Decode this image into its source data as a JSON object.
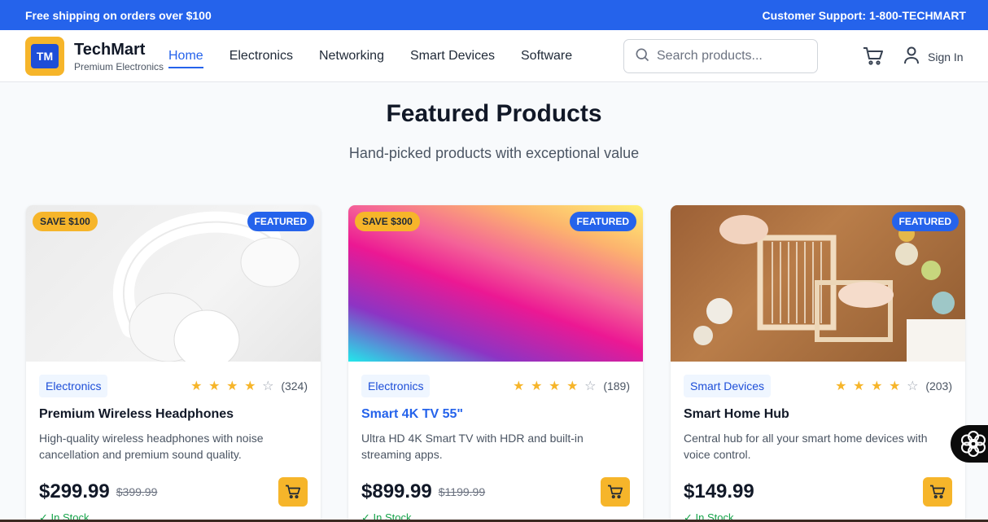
{
  "topbar": {
    "shipping": "Free shipping on orders over $100",
    "support": "Customer Support: 1-800-TECHMART"
  },
  "header": {
    "logo_initials": "TM",
    "brand_name": "TechMart",
    "brand_tagline": "Premium Electronics",
    "nav": [
      "Home",
      "Electronics",
      "Networking",
      "Smart Devices",
      "Software"
    ],
    "active_nav": "Home",
    "search_placeholder": "Search products...",
    "sign_in": "Sign In",
    "cart_icon": "cart-icon",
    "user_icon": "user-icon",
    "search_icon": "search-icon"
  },
  "section": {
    "title": "Featured Products",
    "subtitle": "Hand-picked products with exceptional value"
  },
  "products": [
    {
      "save_badge": "SAVE $100",
      "featured_badge": "FEATURED",
      "category": "Electronics",
      "stars": 4,
      "reviews": "(324)",
      "name": "Premium Wireless Headphones",
      "description": "High-quality wireless headphones with noise cancellation and premium sound quality.",
      "price": "$299.99",
      "old_price": "$399.99",
      "stock": "✓ In Stock"
    },
    {
      "save_badge": "SAVE $300",
      "featured_badge": "FEATURED",
      "category": "Electronics",
      "stars": 4,
      "reviews": "(189)",
      "name": "Smart 4K TV 55\"",
      "description": "Ultra HD 4K Smart TV with HDR and built-in streaming apps.",
      "price": "$899.99",
      "old_price": "$1199.99",
      "stock": "✓ In Stock"
    },
    {
      "save_badge": "",
      "featured_badge": "FEATURED",
      "category": "Smart Devices",
      "stars": 4,
      "reviews": "(203)",
      "name": "Smart Home Hub",
      "description": "Central hub for all your smart home devices with voice control.",
      "price": "$149.99",
      "old_price": "",
      "stock": "✓ In Stock"
    }
  ],
  "colors": {
    "primary": "#2563eb",
    "accent": "#f6b52a",
    "in_stock": "#16a34a"
  }
}
